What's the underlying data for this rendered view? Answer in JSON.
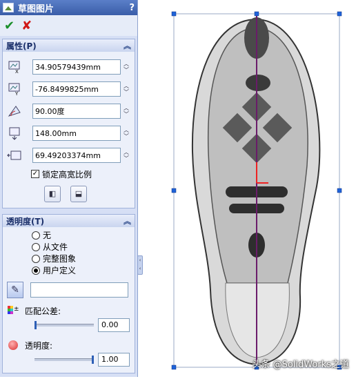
{
  "panel": {
    "title": "草图图片",
    "help": "?",
    "ok_label": "✔",
    "cancel_label": "✘"
  },
  "properties": {
    "header": "属性(P)",
    "fields": [
      {
        "icon": "x-position-icon",
        "value": "34.90579439mm"
      },
      {
        "icon": "y-position-icon",
        "value": "-76.8499825mm"
      },
      {
        "icon": "angle-icon",
        "value": "90.00度"
      },
      {
        "icon": "height-icon",
        "value": "148.00mm"
      },
      {
        "icon": "width-icon",
        "value": "69.49203374mm"
      }
    ],
    "lock_ratio_label": "锁定高宽比例",
    "lock_ratio_checked": true
  },
  "transparency": {
    "header": "透明度(T)",
    "options": [
      "无",
      "从文件",
      "完整图象",
      "用户定义"
    ],
    "selected": "用户定义",
    "match_tolerance_label": "匹配公差:",
    "match_tolerance_value": "0.00",
    "match_tolerance_level": 0.0,
    "opacity_label": "透明度:",
    "opacity_value": "1.00",
    "opacity_level": 1.0
  },
  "canvas": {
    "watermark": "头条 @SolidWorks之道"
  },
  "colors": {
    "title_bar": "#3a5da8",
    "panel_bg": "#d6dff5",
    "handle": "#1f63d9",
    "center_line": "#6a1b6a",
    "ok": "#1a8f2a",
    "cancel": "#d01818"
  }
}
